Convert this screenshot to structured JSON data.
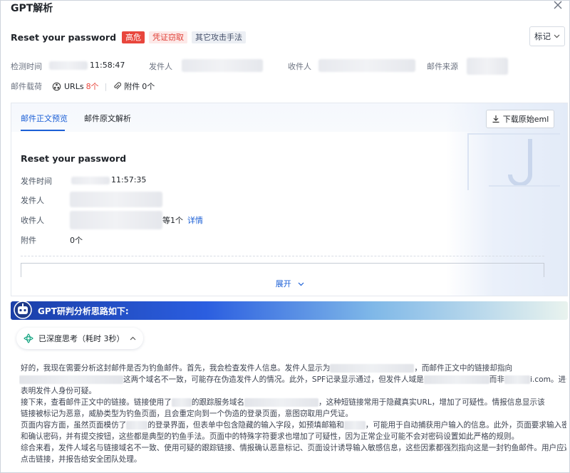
{
  "window": {
    "title": "GPT解析"
  },
  "header": {
    "subject": "Reset your password",
    "tags": [
      "高危",
      "凭证窃取",
      "其它攻击手法"
    ],
    "mark_select": "标记"
  },
  "meta": {
    "detect_time_label": "检测时间",
    "detect_time_value": "11:58:47",
    "sender_label": "发件人",
    "recipient_label": "收件人",
    "source_label": "邮件来源",
    "payload_label": "邮件载荷",
    "urls_label": "URLs",
    "urls_count": "8个",
    "attach_label": "附件",
    "attach_count": "0个"
  },
  "panel": {
    "tabs": [
      "邮件正文预览",
      "邮件原文解析"
    ],
    "download_button": "下载原始eml",
    "mail_subject": "Reset your password",
    "send_time_label": "发件时间",
    "send_time_value": "11:57:35",
    "sender_label": "发件人",
    "recipient_label": "收件人",
    "recipient_suffix": "等1个",
    "recipient_detail_link": "详情",
    "attach_label": "附件",
    "attach_value": "0个",
    "expand_label": "展开"
  },
  "gpt": {
    "banner_title": "GPT研判分析思路如下:",
    "think_label": "已深度思考（耗时 3秒）"
  },
  "analysis": {
    "line1a": "好的，我现在需要分析这封邮件是否为钓鱼邮件。首先，我会检查发件人信息。发件人显示为",
    "line1b": "，而邮件正文中的链接却指向",
    "line2a": "这两个域名不一致，可能存在伪造发件人的情况。此外，SPF记录显示通过，但发件人域是",
    "line2b": "而非",
    "line2c": "i.com。进一步",
    "line3": "表明发件人身份可疑。",
    "line4a": "接下来，查看邮件正文中的链接。链接使用了",
    "line4b": "的跟踪服务域名",
    "line4c": "，这种短链接常用于隐藏真实URL，增加了可疑性。情报信息显示该",
    "line5": "链接被标记为恶意，威胁类型为钓鱼页面，且会重定向到一个伪造的登录页面，意图窃取用户凭证。",
    "line6a": "页面内容方面，虽然页面模仿了",
    "line6b": "的登录界面，但表单中包含隐藏的输入字段，如预填邮箱和",
    "line6c": "，可能用于自动捕获用户输入的信息。此外，页面要求输入密码",
    "line7": "和确认密码，并有提交按钮，这些都是典型的钓鱼手法。页面中的特殊字符要求也增加了可疑性，因为正常企业可能不会对密码设置如此严格的规则。",
    "line8": "综合来看，发件人域名与链接域名不一致、使用可疑的跟踪链接、情报确认恶意标记、页面设计诱导输入敏感信息，这些因素都强烈指向这是一封钓鱼邮件。用户应避免",
    "line9": "点击链接，并报告给安全团队处理。"
  },
  "colors": {
    "accent": "#1b5fd6",
    "danger": "#e8463c"
  }
}
